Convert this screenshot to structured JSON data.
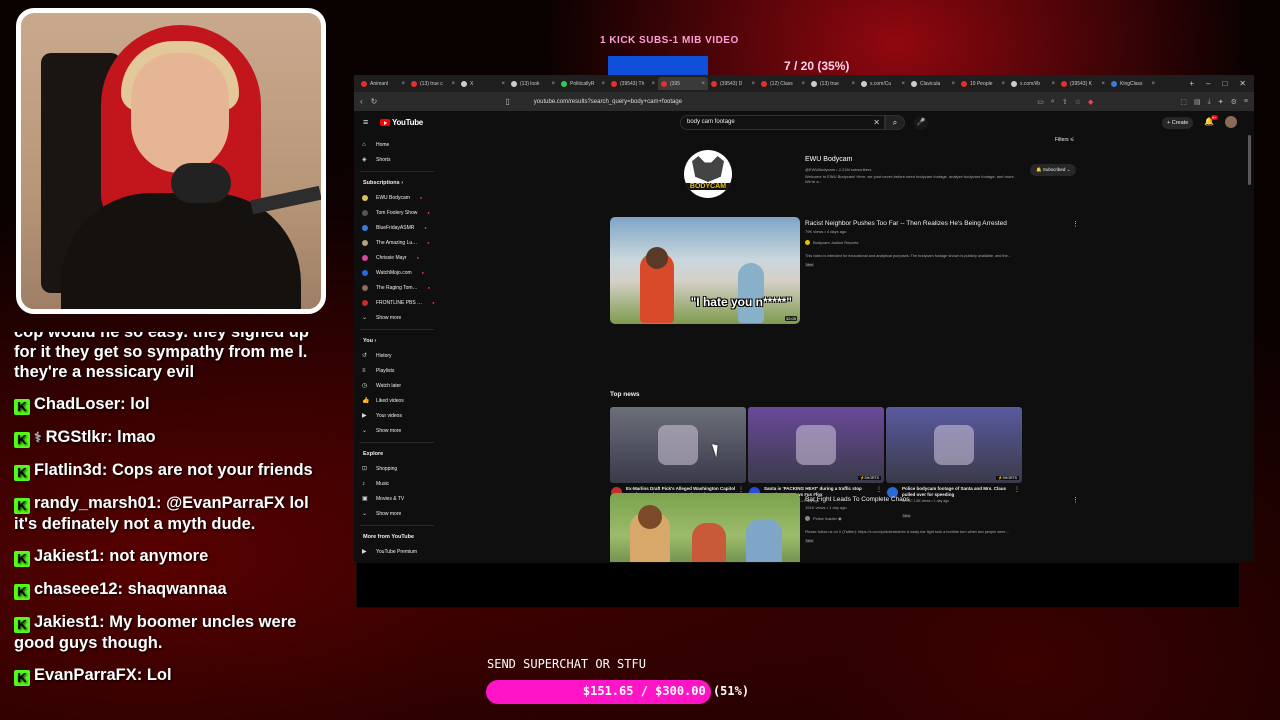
{
  "overlay": {
    "sub_goal_label": "1 KICK SUBS-1 MIB VIDEO",
    "sub_goal_progress": "7 / 20 (35%)",
    "sub_goal_fraction": 0.35,
    "superchat_label": "SEND SUPERCHAT OR STFU",
    "superchat_progress": "$151.65 / $300.00 (51%)",
    "superchat_fraction": 0.51,
    "accent_pink": "#ff14c8",
    "accent_green": "#53fc18"
  },
  "chat": [
    {
      "user": "",
      "text": "cop would he so easy. they signed up for it they get so sympathy from me l. they're a nessicary evil",
      "partial": true
    },
    {
      "user": "ChadLoser:",
      "text": "lol"
    },
    {
      "user": "RGStlkr:",
      "text": "lmao",
      "badge": "⚕"
    },
    {
      "user": "Flatlin3d:",
      "text": "Cops are not your friends"
    },
    {
      "user": "randy_marsh01:",
      "text": "@EvanParraFX lol it's definately not a myth dude."
    },
    {
      "user": "Jakiest1:",
      "text": "not anymore"
    },
    {
      "user": "chaseee12:",
      "text": "shaqwannaa"
    },
    {
      "user": "Jakiest1:",
      "text": "My boomer uncles were good guys though."
    },
    {
      "user": "EvanParraFX:",
      "text": "Lol"
    }
  ],
  "browser": {
    "tabs": [
      {
        "label": "Animanl",
        "color": "#e03030"
      },
      {
        "label": "(13) true c",
        "color": "#e03030"
      },
      {
        "label": "X",
        "color": "#cccccc"
      },
      {
        "label": "(13) look",
        "color": "#cccccc"
      },
      {
        "label": "PoliticallyR",
        "color": "#34c759"
      },
      {
        "label": "(39543) Th",
        "color": "#e03030"
      },
      {
        "label": "(395",
        "color": "#e03030",
        "active": true
      },
      {
        "label": "(39543) D",
        "color": "#e03030"
      },
      {
        "label": "(12) Class",
        "color": "#e03030"
      },
      {
        "label": "(13) true",
        "color": "#cccccc"
      },
      {
        "label": "x.com/Cu",
        "color": "#cccccc"
      },
      {
        "label": "Clavicula",
        "color": "#cccccc"
      },
      {
        "label": "19 People",
        "color": "#e03030"
      },
      {
        "label": "x.com/i/b",
        "color": "#cccccc"
      },
      {
        "label": "(39543) K",
        "color": "#e03030"
      },
      {
        "label": "KingClass",
        "color": "#3a7bd5"
      }
    ],
    "window_controls": [
      "+",
      "‒",
      "□",
      "✕"
    ],
    "url": "youtube.com/results?search_query=body+cam+footage"
  },
  "youtube": {
    "logo_text": "YouTube",
    "search_value": "body cam footage",
    "create_label": "+ Create",
    "notif_count": "9+",
    "filters_label": "Filters",
    "sidebar": {
      "main": [
        {
          "label": "Home",
          "icon": "⌂"
        },
        {
          "label": "Shorts",
          "icon": "◈"
        }
      ],
      "subscriptions_title": "Subscriptions ›",
      "subscriptions": [
        {
          "label": "EWU Bodycam",
          "color": "#d9c05a"
        },
        {
          "label": "Tom Foolery Show",
          "color": "#555555"
        },
        {
          "label": "BlueFridayASMR",
          "color": "#3a7bd5"
        },
        {
          "label": "The Amazing Lu…",
          "color": "#b7a07a"
        },
        {
          "label": "Chrissie Mayr",
          "color": "#d24a9a"
        },
        {
          "label": "WatchMojo.com",
          "color": "#2a6ad8"
        },
        {
          "label": "The Raging Tom…",
          "color": "#8a6b5a"
        },
        {
          "label": "FRONTLINE PBS …",
          "color": "#c92b2b"
        },
        {
          "label": "Show more",
          "color": ""
        }
      ],
      "you_title": "You ›",
      "you": [
        {
          "label": "History",
          "icon": "↺"
        },
        {
          "label": "Playlists",
          "icon": "≡"
        },
        {
          "label": "Watch later",
          "icon": "◷"
        },
        {
          "label": "Liked videos",
          "icon": "👍"
        },
        {
          "label": "Your videos",
          "icon": "▶"
        },
        {
          "label": "Show more",
          "icon": "⌄"
        }
      ],
      "explore_title": "Explore",
      "explore": [
        {
          "label": "Shopping",
          "icon": "⊡"
        },
        {
          "label": "Music",
          "icon": "♪"
        },
        {
          "label": "Movies & TV",
          "icon": "▣"
        },
        {
          "label": "Show more",
          "icon": "⌄"
        }
      ],
      "more_title": "More from YouTube",
      "more": [
        {
          "label": "YouTube Premium",
          "icon": "▶"
        }
      ]
    },
    "channel": {
      "name": "EWU Bodycam",
      "logo_text": "BODYCAM",
      "meta": "@EWUBodycam • 2.21M subscribers",
      "description": "Welcome to EWU Bodycam! Here, we post never-before-seen bodycam footage, analyze bodycam footage, and more. We're a…",
      "subscribed_label": "Subscribed ⌄"
    },
    "video1": {
      "title": "Racist Neighbor Pushes Too Far -- Then Realizes He's Being Arrested",
      "meta": "79K views • 4 days ago",
      "channel": "Bodycam Justice Reports",
      "description": "This video is intended for educational and analytical purposes. The bodycam footage shown is publicly available, and the…",
      "badge": "New",
      "thumb_caption": "\"I hate you n*****\"",
      "duration": "32:05"
    },
    "top_news_title": "Top news",
    "news": [
      {
        "title": "Ex-Marlins Draft Pick's Alleged Washington Capitol Break-In Bodycam Footage Released",
        "meta": "TMZ ◉\n2.2K views • 1 day ago",
        "badge": "New",
        "shorts": "",
        "thumb": "#6c6f7a",
        "avatar": "#c92b2b"
      },
      {
        "title": "Santa is 'PACKING HEAT' during a traffic stop #Fowlnews #news #us #fox",
        "meta": "Fox News ◉\n30K views • 1 day ago",
        "badge": "New",
        "shorts": "⚡SHORTS",
        "thumb": "#6a4a9a",
        "avatar": "#2a4ad8"
      },
      {
        "title": "Police bodycam footage of Santa and Mrs. Claus pulled over for speeding",
        "meta": "WTOC\n1.8K views • 1 day ago",
        "badge": "New",
        "shorts": "⚡SHORTS",
        "thumb": "#5a5aa0",
        "avatar": "#2a6ad8"
      }
    ],
    "video2": {
      "title": "Bar Fight Leads To Complete Chaos",
      "meta": "151K views • 1 day ago",
      "channel": "Police Insider ◉",
      "description": "Please follow us on X (Twitter): https://x.com/policeinsiderhv A nasty bar fight took a horrible turn when two people were…",
      "badge": "New"
    }
  }
}
